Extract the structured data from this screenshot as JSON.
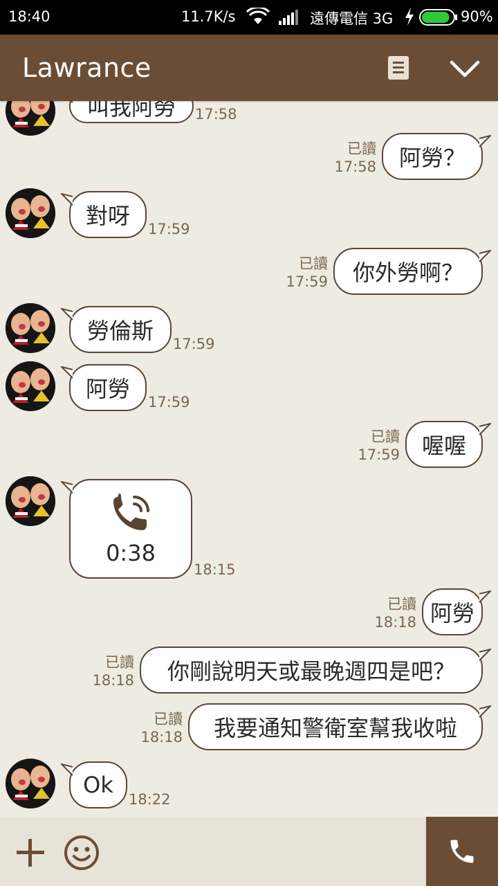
{
  "status_bar": {
    "time": "18:40",
    "net_speed": "11.7K/s",
    "carrier": "遠傳電信 3G",
    "battery_pct": "90%",
    "battery_level": 0.9,
    "icons": [
      "wifi-icon",
      "signal-icon",
      "charging-icon",
      "battery-icon"
    ]
  },
  "header": {
    "title": "Lawrance",
    "icons": [
      "notes-icon",
      "chevron-down-icon"
    ]
  },
  "messages": [
    {
      "dir": "in",
      "text": "叫我阿勞",
      "time": "17:58"
    },
    {
      "dir": "out",
      "text": "阿勞？",
      "read": "已讀",
      "time": "17:58"
    },
    {
      "dir": "in",
      "text": "對呀",
      "time": "17:59"
    },
    {
      "dir": "out",
      "text": "你外勞啊？",
      "read": "已讀",
      "time": "17:59"
    },
    {
      "dir": "in",
      "text": "勞倫斯",
      "time": "17:59"
    },
    {
      "dir": "in",
      "text": "阿勞",
      "time": "17:59"
    },
    {
      "dir": "out",
      "text": "喔喔",
      "read": "已讀",
      "time": "17:59"
    },
    {
      "dir": "in",
      "type": "call",
      "text": "0:38",
      "time": "18:15"
    },
    {
      "dir": "out",
      "text": "阿勞",
      "read": "已讀",
      "time": "18:18"
    },
    {
      "dir": "out",
      "text": "你剛說明天或最晚週四是吧？",
      "read": "已讀",
      "time": "18:18"
    },
    {
      "dir": "out",
      "text": "我要通知警衛室幫我收啦",
      "read": "已讀",
      "time": "18:18"
    },
    {
      "dir": "in",
      "text": "Ok",
      "time": "18:22"
    }
  ],
  "input_bar": {
    "icons": [
      "plus-icon",
      "emoji-icon",
      "phone-icon"
    ]
  },
  "colors": {
    "header_bg": "#6b4d36",
    "chat_bg": "#eeebe2",
    "bubble_border": "#5b4636",
    "meta_text": "#7b6651"
  }
}
